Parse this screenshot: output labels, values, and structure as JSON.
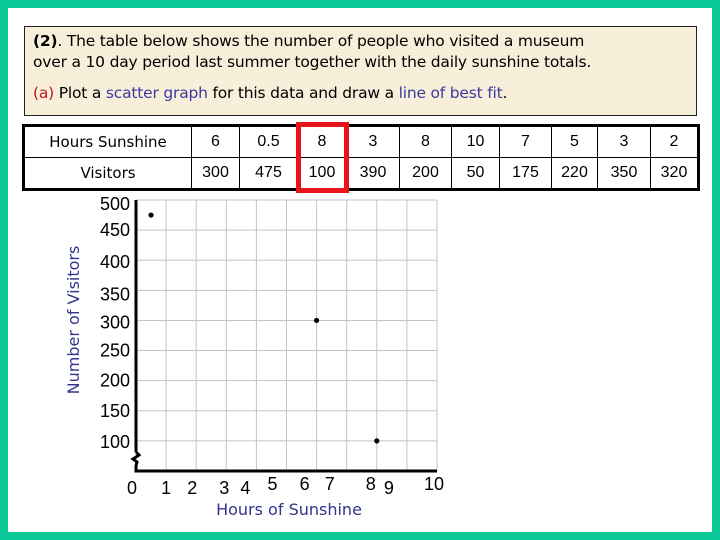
{
  "question": {
    "number": "(2)",
    "text_line1": ". The table below shows the number of people who visited a museum",
    "text_line2": "over a 10 day period last summer together with the daily sunshine totals.",
    "part_label": "(a)",
    "part_text1": " Plot a ",
    "part_highlight1": "scatter graph",
    "part_text2": " for this data and draw a ",
    "part_highlight2": "line of best fit",
    "part_text3": "."
  },
  "table": {
    "row_headers": [
      "Hours Sunshine",
      "Visitors"
    ],
    "hours": [
      "6",
      "0.5",
      "8",
      "3",
      "8",
      "10",
      "7",
      "5",
      "3",
      "2"
    ],
    "visitors": [
      "300",
      "475",
      "100",
      "390",
      "200",
      "50",
      "175",
      "220",
      "350",
      "320"
    ],
    "highlighted_column": 3
  },
  "colors": {
    "border": "#0bc996",
    "highlight": "#e8141a",
    "accent_blue": "#33338f",
    "accent_red": "#c0141e"
  },
  "chart_data": {
    "type": "scatter",
    "title": "",
    "xlabel": "Hours of Sunshine",
    "ylabel": "Number of Visitors",
    "xlim": [
      0,
      10
    ],
    "ylim": [
      50,
      500
    ],
    "grid": true,
    "y_axis_break": true,
    "x_ticks": [
      "0",
      "1",
      "2",
      "3",
      "4",
      "5",
      "6",
      "7",
      "8",
      "9",
      "10"
    ],
    "y_ticks": [
      "500",
      "450",
      "400",
      "350",
      "300",
      "250",
      "200",
      "150",
      "100"
    ],
    "points_plotted": [
      {
        "x": 0.5,
        "y": 475
      },
      {
        "x": 6,
        "y": 300
      },
      {
        "x": 8,
        "y": 100
      }
    ],
    "series": [
      {
        "name": "Hours Sunshine",
        "values": [
          6,
          0.5,
          8,
          3,
          8,
          10,
          7,
          5,
          3,
          2
        ]
      },
      {
        "name": "Visitors",
        "values": [
          300,
          475,
          100,
          390,
          200,
          50,
          175,
          220,
          350,
          320
        ]
      }
    ]
  }
}
